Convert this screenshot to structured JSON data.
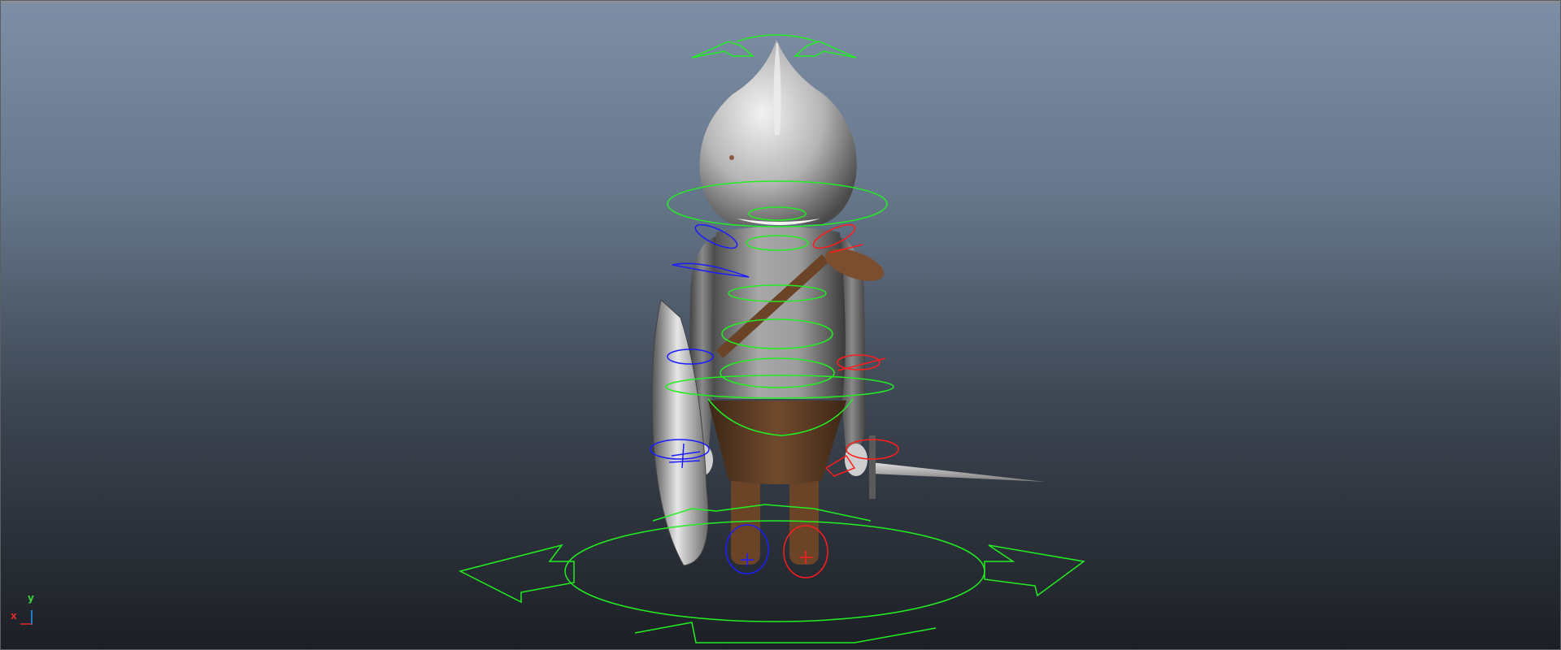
{
  "viewport": {
    "background_top": "#7d8ea6",
    "background_bottom": "#1c1f24"
  },
  "colors": {
    "control_center": "#22ee22",
    "control_left": "#1c1cff",
    "control_right": "#ff1c1c",
    "mesh_gray": "#bdbdbd",
    "leather_brown": "#6b4428"
  },
  "axis_gizmo": {
    "y_label": "y",
    "x_label": "x"
  },
  "icons": [
    "axis-gizmo-icon"
  ]
}
